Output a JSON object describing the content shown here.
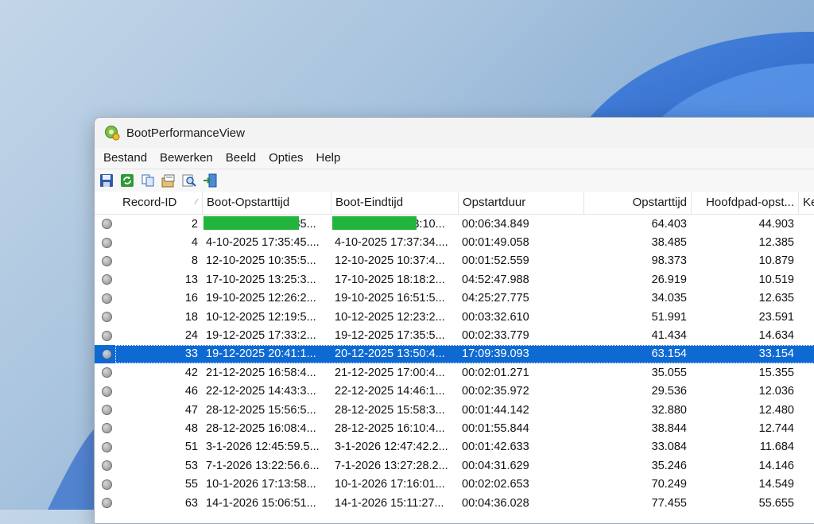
{
  "window": {
    "title": "BootPerformanceView"
  },
  "menu": [
    "Bestand",
    "Bewerken",
    "Beeld",
    "Opties",
    "Help"
  ],
  "toolbar": [
    {
      "icon": "save-icon"
    },
    {
      "icon": "refresh-icon"
    },
    {
      "icon": "copy-icon"
    },
    {
      "icon": "properties-icon"
    },
    {
      "icon": "find-icon"
    },
    {
      "icon": "exit-icon"
    }
  ],
  "columns": [
    "Record-ID",
    "Boot-Opstarttijd",
    "Boot-Eindtijd",
    "Opstartduur",
    "Opstarttijd",
    "Hoofdpad-opst...",
    "Ker"
  ],
  "rows": [
    {
      "id": "2",
      "start": "1-10-2025 14:25:35...",
      "end": "1-10-2025 14:33:10...",
      "duration": "00:06:34.849",
      "boot": "64.403",
      "main": "44.903",
      "redacted": true
    },
    {
      "id": "4",
      "start": "4-10-2025 17:35:45....",
      "end": "4-10-2025 17:37:34....",
      "duration": "00:01:49.058",
      "boot": "38.485",
      "main": "12.385"
    },
    {
      "id": "8",
      "start": "12-10-2025 10:35:5...",
      "end": "12-10-2025 10:37:4...",
      "duration": "00:01:52.559",
      "boot": "98.373",
      "main": "10.879"
    },
    {
      "id": "13",
      "start": "17-10-2025 13:25:3...",
      "end": "17-10-2025 18:18:2...",
      "duration": "04:52:47.988",
      "boot": "26.919",
      "main": "10.519"
    },
    {
      "id": "16",
      "start": "19-10-2025 12:26:2...",
      "end": "19-10-2025 16:51:5...",
      "duration": "04:25:27.775",
      "boot": "34.035",
      "main": "12.635"
    },
    {
      "id": "18",
      "start": "10-12-2025 12:19:5...",
      "end": "10-12-2025 12:23:2...",
      "duration": "00:03:32.610",
      "boot": "51.991",
      "main": "23.591"
    },
    {
      "id": "24",
      "start": "19-12-2025 17:33:2...",
      "end": "19-12-2025 17:35:5...",
      "duration": "00:02:33.779",
      "boot": "41.434",
      "main": "14.634"
    },
    {
      "id": "33",
      "start": "19-12-2025 20:41:1...",
      "end": "20-12-2025 13:50:4...",
      "duration": "17:09:39.093",
      "boot": "63.154",
      "main": "33.154",
      "selected": true
    },
    {
      "id": "42",
      "start": "21-12-2025 16:58:4...",
      "end": "21-12-2025 17:00:4...",
      "duration": "00:02:01.271",
      "boot": "35.055",
      "main": "15.355"
    },
    {
      "id": "46",
      "start": "22-12-2025 14:43:3...",
      "end": "22-12-2025 14:46:1...",
      "duration": "00:02:35.972",
      "boot": "29.536",
      "main": "12.036"
    },
    {
      "id": "47",
      "start": "28-12-2025 15:56:5...",
      "end": "28-12-2025 15:58:3...",
      "duration": "00:01:44.142",
      "boot": "32.880",
      "main": "12.480"
    },
    {
      "id": "48",
      "start": "28-12-2025 16:08:4...",
      "end": "28-12-2025 16:10:4...",
      "duration": "00:01:55.844",
      "boot": "38.844",
      "main": "12.744"
    },
    {
      "id": "51",
      "start": "3-1-2026 12:45:59.5...",
      "end": "3-1-2026 12:47:42.2...",
      "duration": "00:01:42.633",
      "boot": "33.084",
      "main": "11.684"
    },
    {
      "id": "53",
      "start": "7-1-2026 13:22:56.6...",
      "end": "7-1-2026 13:27:28.2...",
      "duration": "00:04:31.629",
      "boot": "35.246",
      "main": "14.146"
    },
    {
      "id": "55",
      "start": "10-1-2026 17:13:58...",
      "end": "10-1-2026 17:16:01...",
      "duration": "00:02:02.653",
      "boot": "70.249",
      "main": "14.549"
    },
    {
      "id": "63",
      "start": "14-1-2026 15:06:51...",
      "end": "14-1-2026 15:11:27...",
      "duration": "00:04:36.028",
      "boot": "77.455",
      "main": "55.655"
    }
  ],
  "colors": {
    "selection": "#0e6ad2",
    "redaction": "#22b43c"
  }
}
